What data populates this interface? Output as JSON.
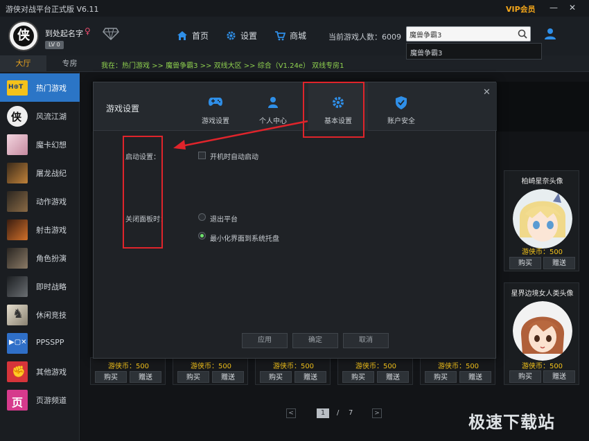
{
  "titlebar": {
    "title": "游侠对战平台正式版 V6.11",
    "vip": "VIP会员",
    "minimize": "—",
    "close": "✕"
  },
  "header": {
    "username": "到处起名字",
    "gender": "♀",
    "level": "LV 0",
    "nav": [
      {
        "label": "首页",
        "icon": "home-icon"
      },
      {
        "label": "设置",
        "icon": "gear-icon"
      },
      {
        "label": "商城",
        "icon": "cart-icon"
      }
    ],
    "online_text": "当前游戏人数：6009",
    "search_value": "魔兽争霸3",
    "dropdown_item": "魔兽争霸3"
  },
  "tabs": {
    "active": "大厅",
    "inactive": "专房"
  },
  "breadcrumb": "我在：热门游戏 >> 魔兽争霸3 >> 双线大区 >> 综合（V1.24e） 双线专房1",
  "sidebar": {
    "items": [
      {
        "label": "热门游戏",
        "icon": "hot-icon",
        "color": "#2b75c6"
      },
      {
        "label": "风流江湖",
        "icon": "wuxia-icon",
        "color": "#eeeeee"
      },
      {
        "label": "魔卡幻想",
        "icon": "card-girl-icon",
        "color": "#d9a3b5"
      },
      {
        "label": "屠龙战纪",
        "icon": "dragon-icon",
        "color": "#8a5a2a"
      },
      {
        "label": "动作游戏",
        "icon": "action-icon",
        "color": "#7a5a3a"
      },
      {
        "label": "射击游戏",
        "icon": "shooter-icon",
        "color": "#a0552a"
      },
      {
        "label": "角色扮演",
        "icon": "rpg-icon",
        "color": "#5a4a3a"
      },
      {
        "label": "即时战略",
        "icon": "rts-icon",
        "color": "#3a3f45"
      },
      {
        "label": "休闲竞技",
        "icon": "chess-icon",
        "color": "#b9b1a0"
      },
      {
        "label": "PPSSPP",
        "icon": "ppsspp-icon",
        "color": "#2f6fc8"
      },
      {
        "label": "其他游戏",
        "icon": "fist-icon",
        "color": "#d6343a"
      },
      {
        "label": "页游频道",
        "icon": "webgame-icon",
        "color": "#d63a8c"
      }
    ]
  },
  "cards": [
    {
      "title": "柏崎星奈头像",
      "price": "游侠币：500",
      "buy": "购买",
      "gift": "赠送"
    },
    {
      "title": "星界边境女人类头像",
      "price": "游侠币：500",
      "buy": "购买",
      "gift": "赠送"
    }
  ],
  "mini_cards": [
    {
      "price": "游侠币：500",
      "buy": "购买",
      "gift": "赠送"
    },
    {
      "price": "游侠币：500",
      "buy": "购买",
      "gift": "赠送"
    },
    {
      "price": "游侠币：500",
      "buy": "购买",
      "gift": "赠送"
    },
    {
      "price": "游侠币：500",
      "buy": "购买",
      "gift": "赠送"
    },
    {
      "price": "游侠币：500",
      "buy": "购买",
      "gift": "赠送"
    }
  ],
  "pagination": {
    "prev": "<",
    "current": "1",
    "separator": "/",
    "total": "7",
    "next": ">"
  },
  "watermark": "极速下载站",
  "dialog": {
    "title": "游戏设置",
    "close": "✕",
    "tabs": [
      {
        "label": "游戏设置",
        "icon": "gamepad-icon"
      },
      {
        "label": "个人中心",
        "icon": "person-icon"
      },
      {
        "label": "基本设置",
        "icon": "gear-icon"
      },
      {
        "label": "账户安全",
        "icon": "shield-icon"
      }
    ],
    "startup_label": "启动设置：",
    "startup_option": "开机时自动启动",
    "close_label": "关闭面板时：",
    "close_options": [
      "退出平台",
      "最小化界面到系统托盘"
    ],
    "buttons": {
      "apply": "应用",
      "ok": "确定",
      "cancel": "取消"
    }
  },
  "accent_colors": {
    "highlight": "#e0242b",
    "selected_radio": "#6ee36b",
    "price": "#f3c21a",
    "vip": "#f3a61a",
    "sidebar_active": "#2b75c6",
    "breadcrumb": "#8fd14f"
  }
}
